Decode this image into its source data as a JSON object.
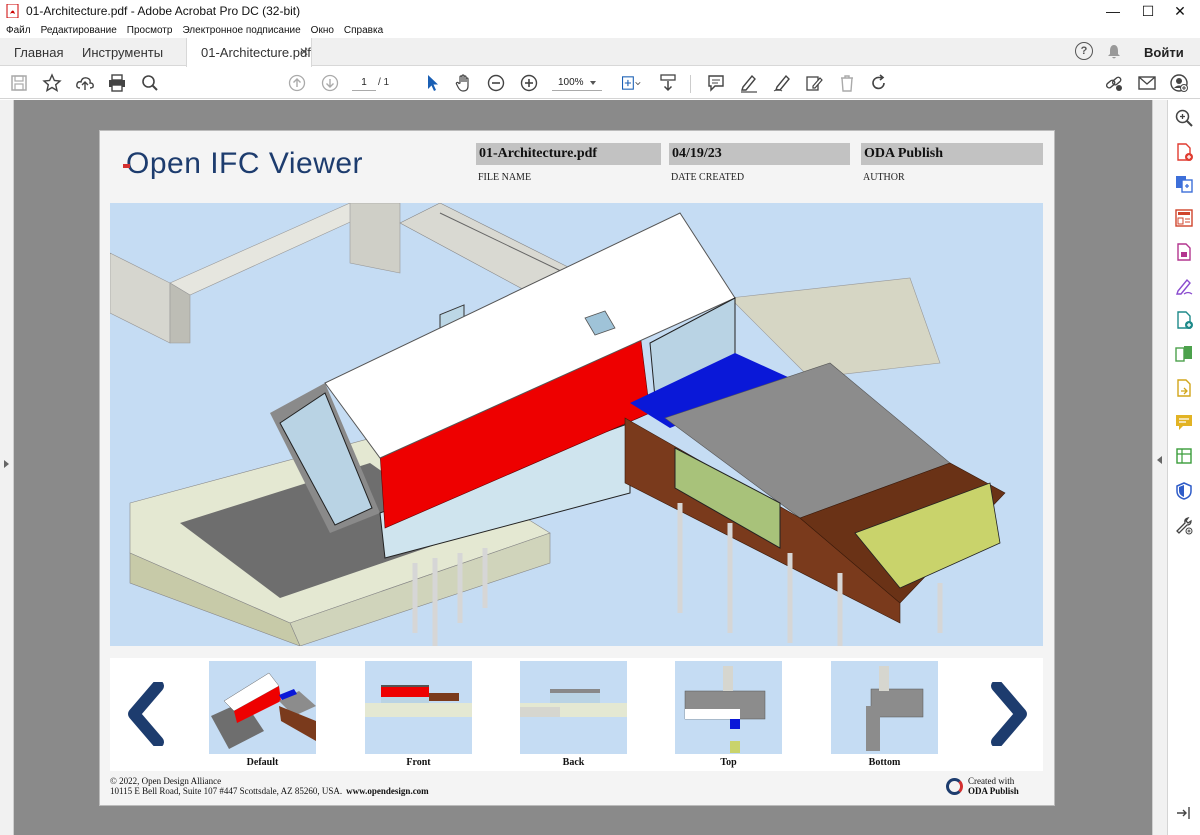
{
  "window": {
    "title": "01-Architecture.pdf - Adobe Acrobat Pro DC (32-bit)",
    "controls": {
      "minimize": "—",
      "maximize": "☐",
      "close": "✕"
    }
  },
  "menu": [
    "Файл",
    "Редактирование",
    "Просмотр",
    "Электронное подписание",
    "Окно",
    "Справка"
  ],
  "tabs": {
    "home": "Главная",
    "tools": "Инструменты",
    "document": "01-Architecture.pdf",
    "close_glyph": "✕",
    "help": "?",
    "login": "Войти"
  },
  "toolbar": {
    "page_current": "1",
    "page_total": "/ 1",
    "zoom": "100%"
  },
  "document": {
    "logo": "Open IFC Viewer",
    "fields": [
      {
        "value": "01-Architecture.pdf",
        "label": "FILE NAME"
      },
      {
        "value": "04/19/23",
        "label": "DATE CREATED"
      },
      {
        "value": "ODA Publish",
        "label": "AUTHOR"
      }
    ],
    "views": [
      "Default",
      "Front",
      "Back",
      "Top",
      "Bottom"
    ],
    "footer": {
      "copyright": "© 2022, Open Design Alliance",
      "address": "10115 E Bell Road, Suite 107 #447 Scottsdale, AZ 85260, USA.",
      "website": "www.opendesign.com",
      "created_with": "Created with",
      "product": "ODA Publish"
    }
  },
  "colors": {
    "brand_navy": "#1d3c6e",
    "brand_red": "#d32f2f",
    "viewport_bg": "#c5dcf3",
    "workspace_bg": "#8a8a8a"
  }
}
